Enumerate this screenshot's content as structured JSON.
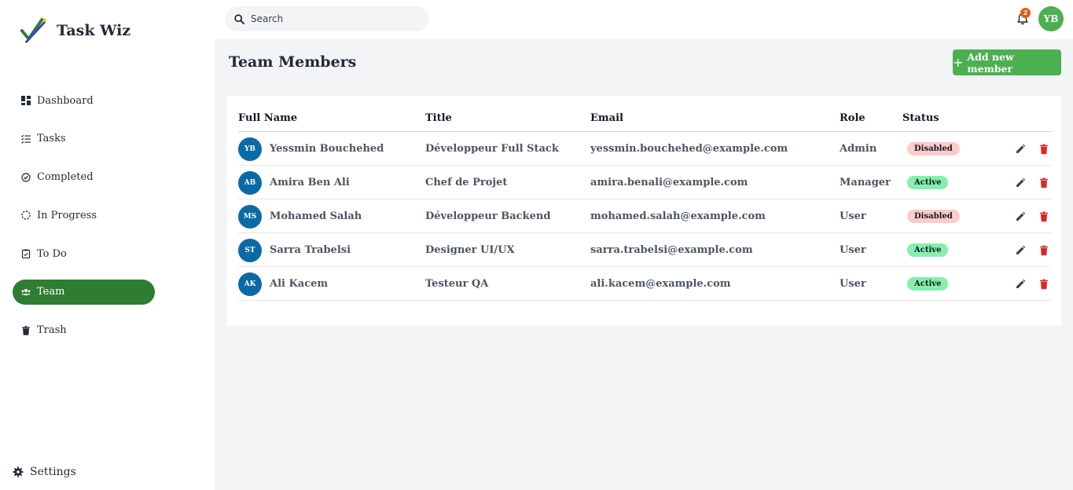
{
  "app": {
    "name": "Task Wiz"
  },
  "sidebar": {
    "items": [
      {
        "label": "Dashboard",
        "icon": "dashboard-icon",
        "active": false
      },
      {
        "label": "Tasks",
        "icon": "tasks-icon",
        "active": false
      },
      {
        "label": "Completed",
        "icon": "check-circle-icon",
        "active": false
      },
      {
        "label": "In Progress",
        "icon": "in-progress-icon",
        "active": false
      },
      {
        "label": "To Do",
        "icon": "clipboard-icon",
        "active": false
      },
      {
        "label": "Team",
        "icon": "team-icon",
        "active": true
      },
      {
        "label": "Trash",
        "icon": "trash-icon",
        "active": false
      }
    ],
    "settings_label": "Settings"
  },
  "topbar": {
    "search_placeholder": "Search",
    "notification_count": "2",
    "user_initials": "YB"
  },
  "page": {
    "title": "Team Members",
    "add_button_label": "Add new member"
  },
  "table": {
    "headers": {
      "full_name": "Full Name",
      "title": "Title",
      "email": "Email",
      "role": "Role",
      "status": "Status"
    },
    "rows": [
      {
        "initials": "YB",
        "name": "Yessmin Bouchehed",
        "title": "Développeur Full Stack",
        "email": "yessmin.bouchehed@example.com",
        "role": "Admin",
        "status": "Disabled"
      },
      {
        "initials": "AB",
        "name": "Amira Ben Ali",
        "title": "Chef de Projet",
        "email": "amira.benali@example.com",
        "role": "Manager",
        "status": "Active"
      },
      {
        "initials": "MS",
        "name": "Mohamed Salah",
        "title": "Développeur Backend",
        "email": "mohamed.salah@example.com",
        "role": "User",
        "status": "Disabled"
      },
      {
        "initials": "ST",
        "name": "Sarra Trabelsi",
        "title": "Designer UI/UX",
        "email": "sarra.trabelsi@example.com",
        "role": "User",
        "status": "Active"
      },
      {
        "initials": "AK",
        "name": "Ali Kacem",
        "title": "Testeur QA",
        "email": "ali.kacem@example.com",
        "role": "User",
        "status": "Active"
      }
    ]
  },
  "colors": {
    "accent_active_nav": "#2e7d32",
    "button_green": "#4caf50",
    "avatar_blue": "#0a6aa5",
    "status_active_bg": "#86efac",
    "status_disabled_bg": "#fecaca",
    "delete_red": "#dc2626",
    "notification_badge": "#ea580c"
  }
}
